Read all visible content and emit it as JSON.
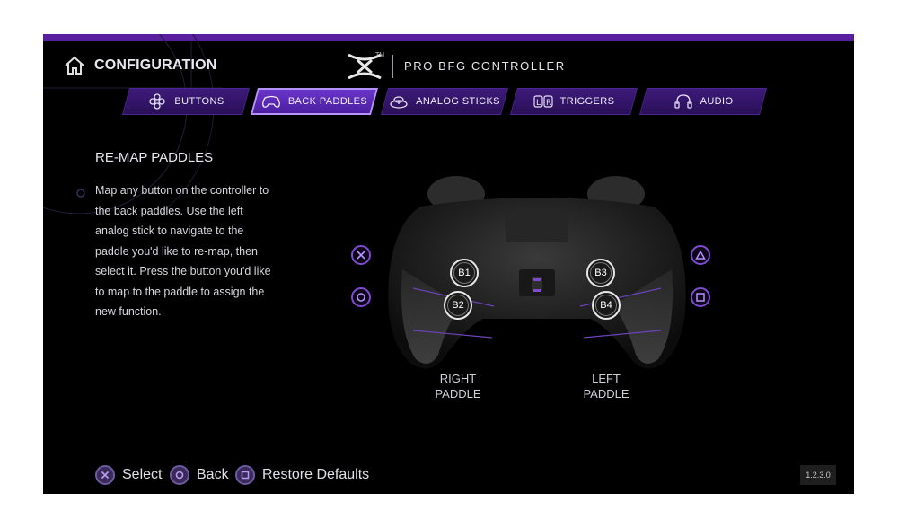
{
  "header": {
    "title": "CONFIGURATION",
    "logo_tm": "TM",
    "product": "PRO BFG CONTROLLER"
  },
  "tabs": [
    {
      "label": "BUTTONS",
      "icon": "dpad-icon",
      "active": false
    },
    {
      "label": "BACK PADDLES",
      "icon": "controller-icon",
      "active": true
    },
    {
      "label": "ANALOG STICKS",
      "icon": "analog-stick-icon",
      "active": false
    },
    {
      "label": "TRIGGERS",
      "icon": "triggers-lr-icon",
      "active": false
    },
    {
      "label": "AUDIO",
      "icon": "headset-icon",
      "active": false
    }
  ],
  "panel": {
    "title": "RE-MAP PADDLES",
    "description": "Map any button on the controller to the back paddles. Use the left analog stick to navigate to the paddle you'd like to re-map, then select it. Press the button you'd like to map to the paddle to assign the new function."
  },
  "paddles": {
    "b1": "B1",
    "b2": "B2",
    "b3": "B3",
    "b4": "B4",
    "right_caption_line1": "RIGHT",
    "right_caption_line2": "PADDLE",
    "left_caption_line1": "LEFT",
    "left_caption_line2": "PADDLE"
  },
  "mapped_buttons": {
    "b1": "cross-icon",
    "b2": "circle-icon",
    "b3": "triangle-icon",
    "b4": "square-icon"
  },
  "footer": {
    "select": "Select",
    "back": "Back",
    "restore": "Restore Defaults",
    "version": "1.2.3.0"
  },
  "colors": {
    "accent": "#5a1f9e",
    "tab_bg": "#3d1a7a",
    "tab_active": "#6a35c9",
    "face_button": "#7d4ad0"
  }
}
